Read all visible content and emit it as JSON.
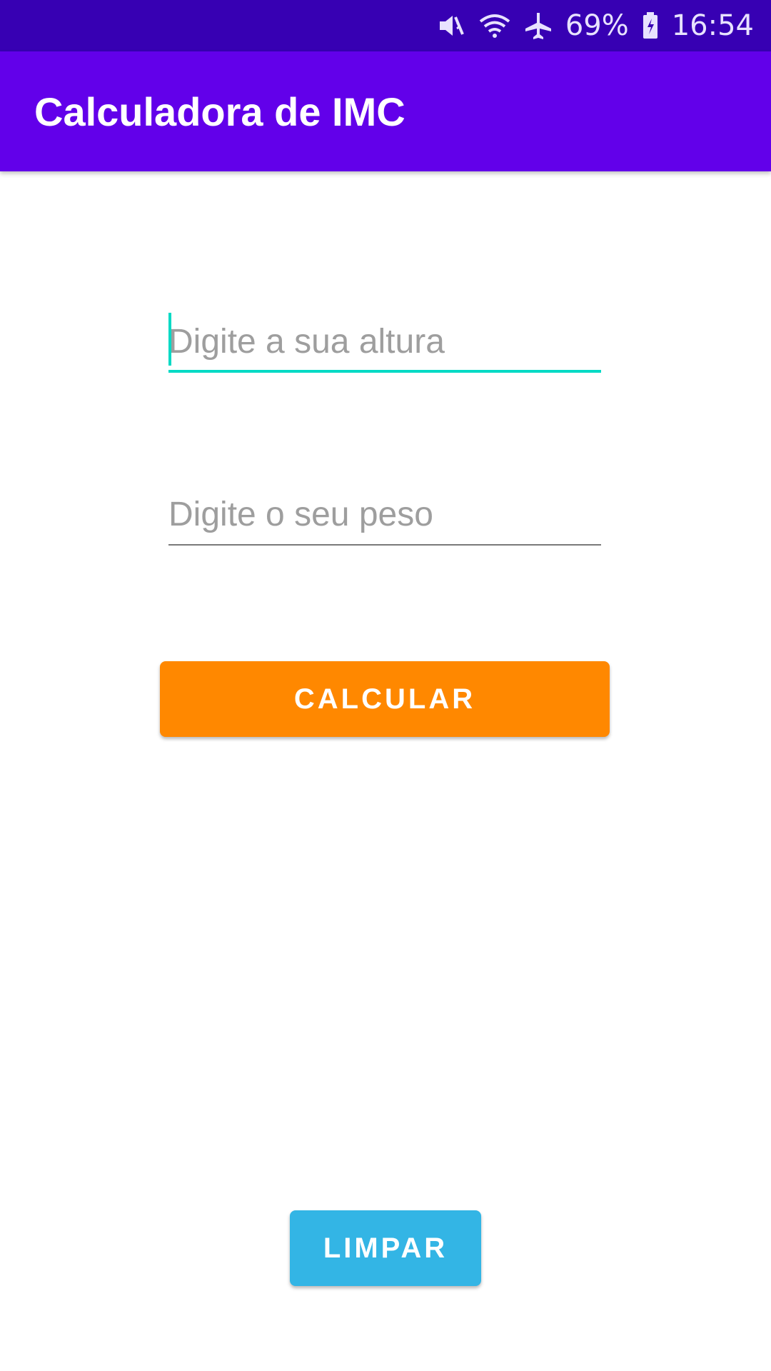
{
  "status_bar": {
    "icons": [
      "mute-icon",
      "wifi-icon",
      "airplane-icon",
      "battery-icon"
    ],
    "battery": "69%",
    "time": "16:54",
    "background": "#3700b3"
  },
  "app_bar": {
    "title": "Calculadora de IMC",
    "background": "#6200ea"
  },
  "form": {
    "height_placeholder": "Digite a sua altura",
    "height_value": "",
    "weight_placeholder": "Digite o seu peso",
    "weight_value": "",
    "focus_color": "#03dac5"
  },
  "buttons": {
    "calculate_label": "CALCULAR",
    "calculate_color": "#ff8800",
    "clear_label": "LIMPAR",
    "clear_color": "#33b5e5"
  }
}
